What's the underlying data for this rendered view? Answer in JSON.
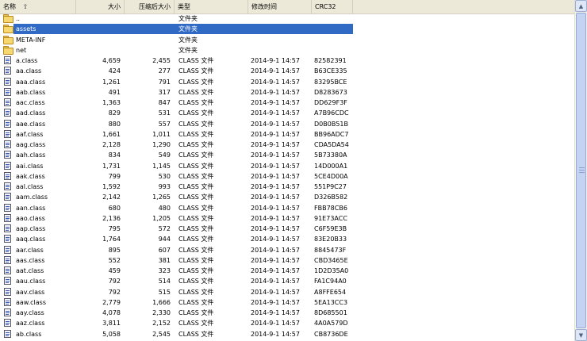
{
  "columns": {
    "name": "名称",
    "size": "大小",
    "packed": "压缩后大小",
    "type": "类型",
    "modified": "修改时间",
    "crc": "CRC32"
  },
  "icons": {
    "sort": "sort-ascending-icon",
    "folder": "folder-icon",
    "file": "class-file-icon"
  },
  "colors": {
    "selection": "#316ac5",
    "header": "#ece9d8"
  },
  "rows": [
    {
      "icon": "folder",
      "name": "..",
      "size": "",
      "packed": "",
      "type": "文件夹",
      "modified": "",
      "crc": "",
      "selected": false
    },
    {
      "icon": "folder",
      "name": "assets",
      "size": "",
      "packed": "",
      "type": "文件夹",
      "modified": "",
      "crc": "",
      "selected": true
    },
    {
      "icon": "folder",
      "name": "META-INF",
      "size": "",
      "packed": "",
      "type": "文件夹",
      "modified": "",
      "crc": "",
      "selected": false
    },
    {
      "icon": "folder",
      "name": "net",
      "size": "",
      "packed": "",
      "type": "文件夹",
      "modified": "",
      "crc": "",
      "selected": false
    },
    {
      "icon": "file",
      "name": "a.class",
      "size": "4,659",
      "packed": "2,455",
      "type": "CLASS 文件",
      "modified": "2014-9-1 14:57",
      "crc": "82582391",
      "selected": false
    },
    {
      "icon": "file",
      "name": "aa.class",
      "size": "424",
      "packed": "277",
      "type": "CLASS 文件",
      "modified": "2014-9-1 14:57",
      "crc": "B63CE335",
      "selected": false
    },
    {
      "icon": "file",
      "name": "aaa.class",
      "size": "1,261",
      "packed": "791",
      "type": "CLASS 文件",
      "modified": "2014-9-1 14:57",
      "crc": "83295BCE",
      "selected": false
    },
    {
      "icon": "file",
      "name": "aab.class",
      "size": "491",
      "packed": "317",
      "type": "CLASS 文件",
      "modified": "2014-9-1 14:57",
      "crc": "D8283673",
      "selected": false
    },
    {
      "icon": "file",
      "name": "aac.class",
      "size": "1,363",
      "packed": "847",
      "type": "CLASS 文件",
      "modified": "2014-9-1 14:57",
      "crc": "DD629F3F",
      "selected": false
    },
    {
      "icon": "file",
      "name": "aad.class",
      "size": "829",
      "packed": "531",
      "type": "CLASS 文件",
      "modified": "2014-9-1 14:57",
      "crc": "A7B96CDC",
      "selected": false
    },
    {
      "icon": "file",
      "name": "aae.class",
      "size": "880",
      "packed": "557",
      "type": "CLASS 文件",
      "modified": "2014-9-1 14:57",
      "crc": "D0B0B51B",
      "selected": false
    },
    {
      "icon": "file",
      "name": "aaf.class",
      "size": "1,661",
      "packed": "1,011",
      "type": "CLASS 文件",
      "modified": "2014-9-1 14:57",
      "crc": "BB96ADC7",
      "selected": false
    },
    {
      "icon": "file",
      "name": "aag.class",
      "size": "2,128",
      "packed": "1,290",
      "type": "CLASS 文件",
      "modified": "2014-9-1 14:57",
      "crc": "CDA5DA54",
      "selected": false
    },
    {
      "icon": "file",
      "name": "aah.class",
      "size": "834",
      "packed": "549",
      "type": "CLASS 文件",
      "modified": "2014-9-1 14:57",
      "crc": "5B73380A",
      "selected": false
    },
    {
      "icon": "file",
      "name": "aai.class",
      "size": "1,731",
      "packed": "1,145",
      "type": "CLASS 文件",
      "modified": "2014-9-1 14:57",
      "crc": "14D000A1",
      "selected": false
    },
    {
      "icon": "file",
      "name": "aak.class",
      "size": "799",
      "packed": "530",
      "type": "CLASS 文件",
      "modified": "2014-9-1 14:57",
      "crc": "5CE4D00A",
      "selected": false
    },
    {
      "icon": "file",
      "name": "aal.class",
      "size": "1,592",
      "packed": "993",
      "type": "CLASS 文件",
      "modified": "2014-9-1 14:57",
      "crc": "551P9C27",
      "selected": false
    },
    {
      "icon": "file",
      "name": "aam.class",
      "size": "2,142",
      "packed": "1,265",
      "type": "CLASS 文件",
      "modified": "2014-9-1 14:57",
      "crc": "D326B582",
      "selected": false
    },
    {
      "icon": "file",
      "name": "aan.class",
      "size": "680",
      "packed": "480",
      "type": "CLASS 文件",
      "modified": "2014-9-1 14:57",
      "crc": "FBB78CB6",
      "selected": false
    },
    {
      "icon": "file",
      "name": "aao.class",
      "size": "2,136",
      "packed": "1,205",
      "type": "CLASS 文件",
      "modified": "2014-9-1 14:57",
      "crc": "91E73ACC",
      "selected": false
    },
    {
      "icon": "file",
      "name": "aap.class",
      "size": "795",
      "packed": "572",
      "type": "CLASS 文件",
      "modified": "2014-9-1 14:57",
      "crc": "C6F59E3B",
      "selected": false
    },
    {
      "icon": "file",
      "name": "aaq.class",
      "size": "1,764",
      "packed": "944",
      "type": "CLASS 文件",
      "modified": "2014-9-1 14:57",
      "crc": "83E20B33",
      "selected": false
    },
    {
      "icon": "file",
      "name": "aar.class",
      "size": "895",
      "packed": "607",
      "type": "CLASS 文件",
      "modified": "2014-9-1 14:57",
      "crc": "8845473F",
      "selected": false
    },
    {
      "icon": "file",
      "name": "aas.class",
      "size": "552",
      "packed": "381",
      "type": "CLASS 文件",
      "modified": "2014-9-1 14:57",
      "crc": "CBD3465E",
      "selected": false
    },
    {
      "icon": "file",
      "name": "aat.class",
      "size": "459",
      "packed": "323",
      "type": "CLASS 文件",
      "modified": "2014-9-1 14:57",
      "crc": "1D2D35A0",
      "selected": false
    },
    {
      "icon": "file",
      "name": "aau.class",
      "size": "792",
      "packed": "514",
      "type": "CLASS 文件",
      "modified": "2014-9-1 14:57",
      "crc": "FA1C94A0",
      "selected": false
    },
    {
      "icon": "file",
      "name": "aav.class",
      "size": "792",
      "packed": "515",
      "type": "CLASS 文件",
      "modified": "2014-9-1 14:57",
      "crc": "A8FFE654",
      "selected": false
    },
    {
      "icon": "file",
      "name": "aaw.class",
      "size": "2,779",
      "packed": "1,666",
      "type": "CLASS 文件",
      "modified": "2014-9-1 14:57",
      "crc": "5EA13CC3",
      "selected": false
    },
    {
      "icon": "file",
      "name": "aay.class",
      "size": "4,078",
      "packed": "2,330",
      "type": "CLASS 文件",
      "modified": "2014-9-1 14:57",
      "crc": "8D685501",
      "selected": false
    },
    {
      "icon": "file",
      "name": "aaz.class",
      "size": "3,811",
      "packed": "2,152",
      "type": "CLASS 文件",
      "modified": "2014-9-1 14:57",
      "crc": "4A0A579D",
      "selected": false
    },
    {
      "icon": "file",
      "name": "ab.class",
      "size": "5,058",
      "packed": "2,545",
      "type": "CLASS 文件",
      "modified": "2014-9-1 14:57",
      "crc": "CB8736DE",
      "selected": false
    }
  ]
}
